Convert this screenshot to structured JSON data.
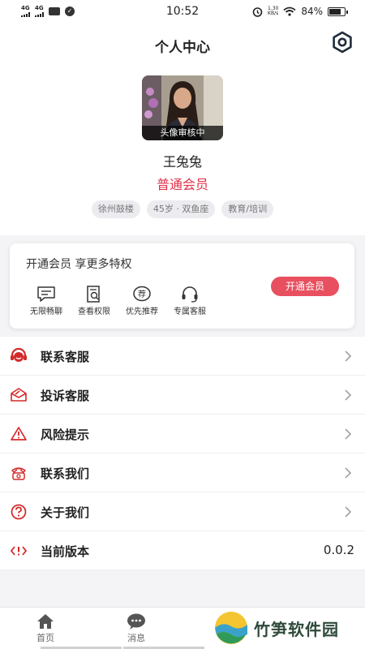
{
  "status_bar": {
    "sim1": "4G",
    "sim2": "4G",
    "time": "10:52",
    "speed_value": "1.30",
    "speed_unit": "KB/s",
    "battery": "84%"
  },
  "header": {
    "title": "个人中心",
    "settings_icon": "hexagon-settings-icon"
  },
  "profile": {
    "avatar_badge": "头像审核中",
    "name": "王兔兔",
    "member_level": "普通会员",
    "tags": [
      "徐州鼓楼",
      "45岁 · 双鱼座",
      "教育/培训"
    ]
  },
  "vip_card": {
    "title": "开通会员 享更多特权",
    "perks": [
      {
        "label": "无限畅聊",
        "icon": "chat-icon"
      },
      {
        "label": "查看权限",
        "icon": "search-doc-icon"
      },
      {
        "label": "优先推荐",
        "icon": "recommend-icon",
        "icon_text": "荐"
      },
      {
        "label": "专属客服",
        "icon": "headset-icon"
      }
    ],
    "button": "开通会员"
  },
  "menu": [
    {
      "label": "联系客服",
      "icon": "customer-service-icon"
    },
    {
      "label": "投诉客服",
      "icon": "complaint-icon"
    },
    {
      "label": "风险提示",
      "icon": "warning-icon"
    },
    {
      "label": "联系我们",
      "icon": "phone-icon"
    },
    {
      "label": "关于我们",
      "icon": "question-icon"
    },
    {
      "label": "当前版本",
      "icon": "version-icon",
      "value": "0.0.2"
    }
  ],
  "tabbar": {
    "home": "首页",
    "messages": "消息"
  },
  "watermark": {
    "text": "竹笋软件园"
  },
  "colors": {
    "accent": "#e0304a",
    "button": "#e8505f"
  }
}
